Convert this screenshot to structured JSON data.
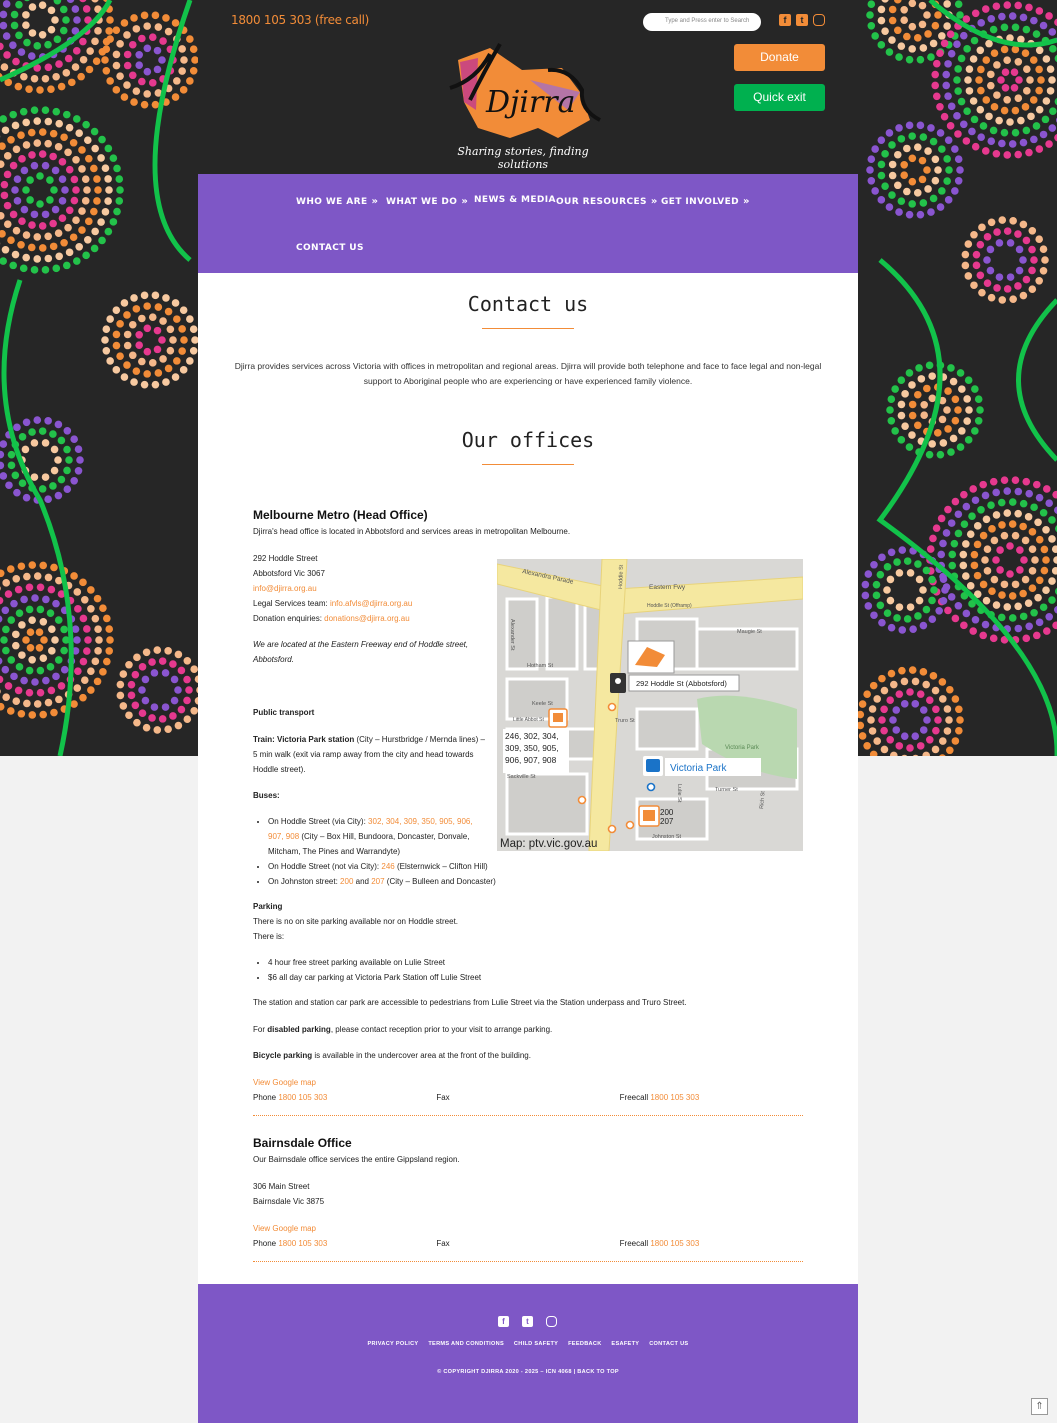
{
  "header": {
    "phone": "1800 105 303 (free call)",
    "search_placeholder": "Type and Press enter to Search",
    "donate": "Donate",
    "quick_exit": "Quick exit",
    "logo_text": "Djirra",
    "tagline": "Sharing stories, finding solutions"
  },
  "nav": {
    "items": [
      "WHO WE ARE",
      "WHAT WE DO",
      "NEWS & MEDIA",
      "OUR RESOURCES",
      "GET INVOLVED",
      "CONTACT US"
    ]
  },
  "main": {
    "title": "Contact us",
    "intro": "Djirra provides services across Victoria with offices in metropolitan and regional areas. Djirra will provide both telephone and face to face legal and non-legal support to Aboriginal people who are experiencing or have experienced family violence.",
    "offices_title": "Our offices"
  },
  "melbourne": {
    "heading": "Melbourne Metro (Head Office)",
    "desc": "Djirra's head office is located in Abbotsford and services areas in metropolitan Melbourne.",
    "addr1": "292 Hoddle Street",
    "addr2": "Abbotsford Vic  3067",
    "email": "info@djirra.org.au",
    "legal_label": "Legal Services team: ",
    "legal_email": "info.afvls@djirra.org.au",
    "donation_label": "Donation enquiries: ",
    "donation_email": "donations@djirra.org.au",
    "location_note": "We are located at the Eastern Freeway end of Hoddle street, Abbotsford.",
    "pt_heading": "Public transport",
    "train_label": "Train: Victoria Park station",
    "train_text": " (City – Hurstbridge / Mernda lines) – 5 min walk (exit via ramp away from the city and head towards Hoddle street).",
    "buses_heading": "Buses:",
    "bus1_pre": "On Hoddle Street (via City): ",
    "bus1_links": "302, 304, 309, 350, 905, 906, 907, 908",
    "bus1_post": " (City – Box Hill, Bundoora, Doncaster, Donvale, Mitcham, The Pines and Warrandyte)",
    "bus2_pre": "On Hoddle Street (not via City): ",
    "bus2_link": "246",
    "bus2_post": " (Elsternwick – Clifton Hill)",
    "bus3_pre": "On Johnston street: ",
    "bus3_link1": "200",
    "bus3_mid": " and ",
    "bus3_link2": "207",
    "bus3_post": " (City – Bulleen and Doncaster)",
    "parking_heading": "Parking",
    "parking_text1": "There is no on site parking available nor on Hoddle street.",
    "parking_text2": "There is:",
    "parking_items": [
      "4 hour free street parking available on Lulie Street",
      "$6 all day car parking at Victoria Park Station off Lulie Street"
    ],
    "station_note": "The station and station car park are accessible to pedestrians from Lulie Street via the Station underpass and Truro Street.",
    "disabled_pre": "For ",
    "disabled_bold": "disabled parking",
    "disabled_post": ", please contact reception prior to your visit to arrange parking.",
    "bicycle_bold": "Bicycle parking",
    "bicycle_post": " is available in the undercover area at the front of the building.",
    "map_link": "View Google map",
    "phone_label": "Phone ",
    "phone": "1800 105 303",
    "fax_label": "Fax",
    "freecall_label": "Freecall ",
    "freecall": "1800 105 303"
  },
  "map": {
    "address_label": "292 Hoddle St (Abbotsford)",
    "bus_routes": "246, 302, 304, 309, 350, 905, 906, 907, 908",
    "station": "Victoria Park",
    "bus_200": "200",
    "bus_207": "207",
    "credit": "Map: ptv.vic.gov.au",
    "streets": [
      "Alexandra Parade",
      "Eastern Fwy",
      "Hoddle St",
      "Hoddle St (Offramp)",
      "Alexander St",
      "Maugie St",
      "Hotham St",
      "Keele St",
      "Little Abbot St",
      "Truro St",
      "Sackville St",
      "Turner St",
      "Lulie St",
      "Rich St",
      "Johnston St",
      "Victoria Park"
    ]
  },
  "bairnsdale": {
    "heading": "Bairnsdale Office",
    "desc": "Our Bairnsdale office services the entire Gippsland region.",
    "addr1": "306 Main Street",
    "addr2": "Bairnsdale  Vic  3875",
    "map_link": "View Google map",
    "phone_label": "Phone ",
    "phone": "1800 105 303",
    "fax_label": "Fax",
    "freecall_label": "Freecall ",
    "freecall": "1800 105 303"
  },
  "footer": {
    "links": [
      "PRIVACY POLICY",
      "TERMS AND CONDITIONS",
      "CHILD SAFETY",
      "FEEDBACK",
      "ESAFETY",
      "CONTACT US"
    ],
    "copyright": "© COPYRIGHT DJIRRA 2020 - 2025 – ICN 4068 | BACK TO TOP"
  },
  "colors": {
    "accent": "#f28c38",
    "purple": "#7e57c6",
    "green": "#00b04f",
    "dark": "#262626"
  },
  "icons": [
    "facebook-icon",
    "twitter-icon",
    "instagram-icon",
    "search-icon",
    "chevron-down-icon",
    "back-to-top-icon"
  ]
}
